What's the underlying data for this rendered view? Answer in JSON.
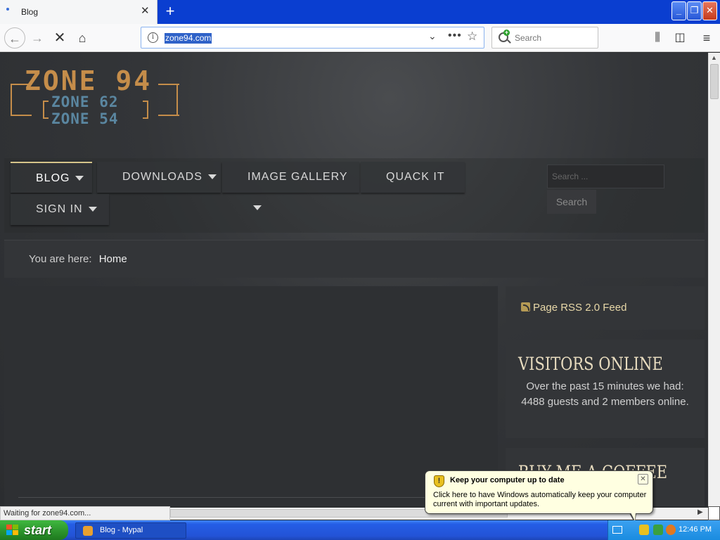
{
  "browser": {
    "tab_title": "Blog",
    "tab_close": "✕",
    "new_tab": "+",
    "url": "zone94.com",
    "search_placeholder": "Search",
    "status_text": "Waiting for zone94.com..."
  },
  "site": {
    "logo": {
      "line1": "ZONE 94",
      "line2": "ZONE 62",
      "line3": "ZONE 54"
    },
    "nav": [
      {
        "label": "BLOG",
        "has_caret": true,
        "active": true
      },
      {
        "label": "DOWNLOADS",
        "has_caret": true
      },
      {
        "label": "IMAGE GALLERY",
        "has_caret": true
      },
      {
        "label": "QUACK IT",
        "has_caret": false
      },
      {
        "label": "SIGN IN",
        "has_caret": true
      }
    ],
    "search_placeholder": "Search ...",
    "search_button": "Search",
    "breadcrumb": {
      "prefix": "You are here:",
      "current": "Home"
    },
    "sidebar": {
      "rss_label": "Page RSS 2.0 Feed",
      "visitors_heading": "VISITORS ONLINE",
      "visitors_text": "Over the past 15 minutes we had: 4488 guests and 2 members online.",
      "coffee_heading": "BUY ME A COFFEE"
    }
  },
  "balloon": {
    "title": "Keep your computer up to date",
    "message": "Click here to have Windows automatically keep your computer current with important updates."
  },
  "taskbar": {
    "start_label": "start",
    "task_item": "Blog - Mypal",
    "clock": "12:46 PM"
  },
  "colors": {
    "accent_gold": "#c58d4a",
    "heading_cream": "#e8dcbf",
    "xp_blue": "#245de6",
    "xp_green": "#2b912b"
  }
}
